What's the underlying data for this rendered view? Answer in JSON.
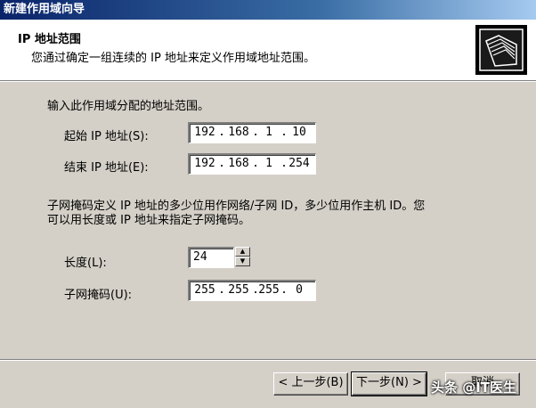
{
  "window": {
    "title": "新建作用域向导"
  },
  "header": {
    "title": "IP 地址范围",
    "subtitle": "您通过确定一组连续的 IP 地址来定义作用域地址范围。",
    "icon": "folders-icon"
  },
  "range_section": {
    "prompt": "输入此作用域分配的地址范围。",
    "start_label": "起始 IP 地址(S):",
    "end_label": "结束 IP 地址(E):",
    "start_ip": [
      "192",
      "168",
      "1",
      "10"
    ],
    "end_ip": [
      "192",
      "168",
      "1",
      "254"
    ]
  },
  "mask_section": {
    "description_line1": "子网掩码定义 IP 地址的多少位用作网络/子网 ID，多少位用作主机 ID。您",
    "description_line2": "可以用长度或 IP 地址来指定子网掩码。",
    "length_label": "长度(L):",
    "length_value": "24",
    "mask_label": "子网掩码(U):",
    "mask_ip": [
      "255",
      "255",
      "255",
      "0"
    ]
  },
  "buttons": {
    "back": "< 上一步(B)",
    "next": "下一步(N) >",
    "cancel": "取消"
  },
  "watermark": "头条 @IT医生",
  "colors": {
    "title_bar": "#0a246a",
    "dialog_bg": "#d4d0c8"
  }
}
